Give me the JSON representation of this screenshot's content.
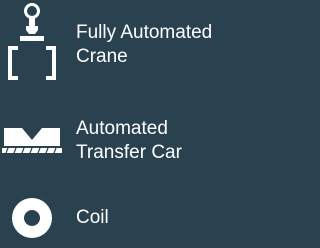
{
  "colors": {
    "background": "#2a4150",
    "icon": "#ffffff",
    "text": "#ffffff"
  },
  "legend": {
    "items": [
      {
        "icon": "crane-icon",
        "line1": "Fully Automated",
        "line2": "Crane"
      },
      {
        "icon": "transfer-car-icon",
        "line1": "Automated",
        "line2": "Transfer Car"
      },
      {
        "icon": "coil-icon",
        "line1": "Coil"
      }
    ]
  }
}
